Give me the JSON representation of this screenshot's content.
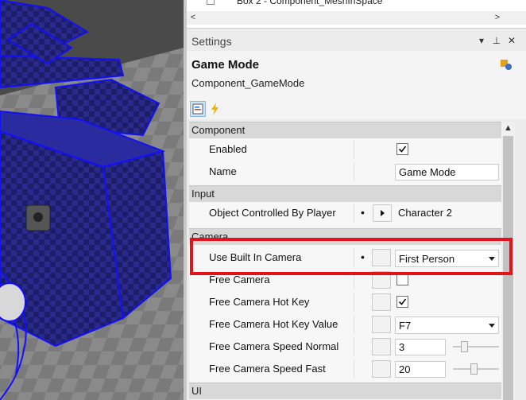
{
  "tree": {
    "row_label": "Box 2 - Component_MeshInSpace",
    "scroll_left": "<",
    "scroll_right": ">"
  },
  "settings_panel": {
    "title": "Settings",
    "dropdown_icon": "▾",
    "pin_icon": "⊥",
    "close_icon": "✕"
  },
  "object": {
    "name": "Game Mode",
    "type": "Component_GameMode"
  },
  "mode_buttons": [
    "properties-icon",
    "events-icon"
  ],
  "grid": {
    "categories": {
      "component": "Component",
      "input": "Input",
      "camera": "Camera",
      "ui": "UI"
    },
    "rows": {
      "enabled": {
        "label": "Enabled",
        "checked": true
      },
      "name": {
        "label": "Name",
        "value": "Game Mode"
      },
      "object_controlled": {
        "label": "Object Controlled By Player",
        "value": "Character 2"
      },
      "use_built_in_camera": {
        "label": "Use Built In Camera",
        "value": "First Person"
      },
      "free_camera": {
        "label": "Free Camera",
        "checked": false
      },
      "free_camera_hot_key": {
        "label": "Free Camera Hot Key",
        "checked": true
      },
      "free_camera_hot_key_value": {
        "label": "Free Camera Hot Key Value",
        "value": "F7"
      },
      "free_camera_speed_normal": {
        "label": "Free Camera Speed Normal",
        "value": "3",
        "slider_fraction": 0.2
      },
      "free_camera_speed_fast": {
        "label": "Free Camera Speed Fast",
        "value": "20",
        "slider_fraction": 0.45
      }
    }
  },
  "colors": {
    "highlight": "#e3131b",
    "viewport_mesh": "#1a1aa8"
  }
}
